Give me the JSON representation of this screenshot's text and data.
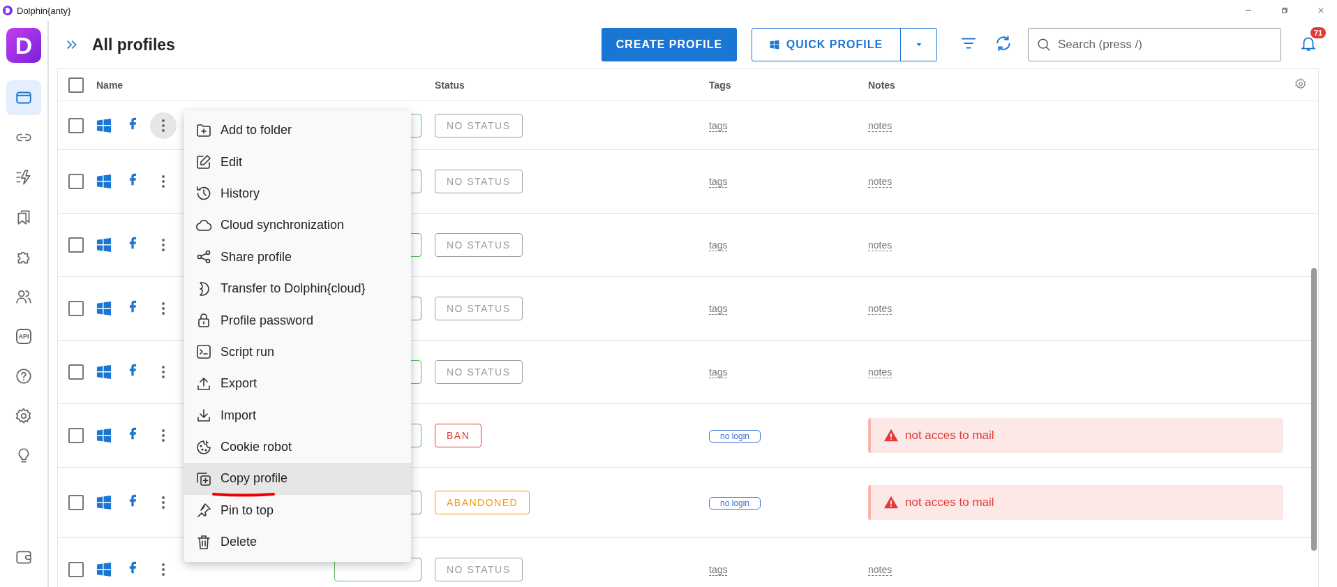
{
  "window": {
    "title": "Dolphin{anty}"
  },
  "sidebar": {
    "logo": "D",
    "items": [
      {
        "kind": "browser",
        "selected": true
      },
      {
        "kind": "link",
        "selected": false
      },
      {
        "kind": "automation",
        "selected": false
      },
      {
        "kind": "bookmarks",
        "selected": false
      },
      {
        "kind": "extension",
        "selected": false
      },
      {
        "kind": "users",
        "selected": false
      },
      {
        "kind": "api",
        "label": "API",
        "selected": false
      },
      {
        "kind": "help",
        "selected": false
      },
      {
        "kind": "settings",
        "selected": false
      },
      {
        "kind": "idea",
        "selected": false
      },
      {
        "kind": "wallet",
        "selected": false
      }
    ]
  },
  "header": {
    "title": "All profiles",
    "create_button": "CREATE PROFILE",
    "quick_button": "QUICK PROFILE",
    "search": {
      "placeholder": "Search (press /)"
    },
    "notifications": "71"
  },
  "table": {
    "select_all_checked": false,
    "columns": [
      "Name",
      "Status",
      "Tags",
      "Notes"
    ],
    "rows": [
      {
        "checked": false,
        "menu_open": true,
        "status": {
          "text": "NO STATUS",
          "color": "#9e9e9e"
        },
        "tags": {
          "kind": "placeholder",
          "text": "tags"
        },
        "notes": {
          "kind": "placeholder",
          "text": "notes"
        }
      },
      {
        "checked": false,
        "menu_open": false,
        "status": {
          "text": "NO STATUS",
          "color": "#9e9e9e"
        },
        "tags": {
          "kind": "placeholder",
          "text": "tags"
        },
        "notes": {
          "kind": "placeholder",
          "text": "notes"
        }
      },
      {
        "checked": false,
        "menu_open": false,
        "status": {
          "text": "NO STATUS",
          "color": "#9e9e9e"
        },
        "tags": {
          "kind": "placeholder",
          "text": "tags"
        },
        "notes": {
          "kind": "placeholder",
          "text": "notes"
        }
      },
      {
        "checked": false,
        "menu_open": false,
        "status": {
          "text": "NO STATUS",
          "color": "#9e9e9e"
        },
        "tags": {
          "kind": "placeholder",
          "text": "tags"
        },
        "notes": {
          "kind": "placeholder",
          "text": "notes"
        }
      },
      {
        "checked": false,
        "menu_open": false,
        "status": {
          "text": "NO STATUS",
          "color": "#9e9e9e"
        },
        "tags": {
          "kind": "placeholder",
          "text": "tags"
        },
        "notes": {
          "kind": "placeholder",
          "text": "notes"
        }
      },
      {
        "checked": false,
        "menu_open": false,
        "status": {
          "text": "BAN",
          "color": "#e53935"
        },
        "tags": {
          "kind": "tag",
          "text": "no login"
        },
        "notes": {
          "kind": "alert",
          "text": "not acces to mail"
        }
      },
      {
        "checked": false,
        "menu_open": false,
        "status": {
          "text": "ABANDONED",
          "color": "#ff9800"
        },
        "tags": {
          "kind": "tag",
          "text": "no login"
        },
        "notes": {
          "kind": "alert",
          "text": "not acces to mail"
        }
      },
      {
        "checked": false,
        "menu_open": false,
        "status": {
          "text": "NO STATUS",
          "color": "#9e9e9e"
        },
        "tags": {
          "kind": "placeholder",
          "text": "tags"
        },
        "notes": {
          "kind": "placeholder",
          "text": "notes"
        }
      }
    ]
  },
  "context_menu": {
    "items": [
      {
        "kind": "folder-plus",
        "label": "Add to folder",
        "selected": false
      },
      {
        "kind": "edit",
        "label": "Edit",
        "selected": false
      },
      {
        "kind": "history",
        "label": "History",
        "selected": false
      },
      {
        "kind": "cloud",
        "label": "Cloud synchronization",
        "selected": false
      },
      {
        "kind": "share",
        "label": "Share profile",
        "selected": false
      },
      {
        "kind": "transfer",
        "label": "Transfer to Dolphin{cloud}",
        "selected": false
      },
      {
        "kind": "lock",
        "label": "Profile password",
        "selected": false
      },
      {
        "kind": "terminal",
        "label": "Script run",
        "selected": false
      },
      {
        "kind": "upload",
        "label": "Export",
        "selected": false
      },
      {
        "kind": "download",
        "label": "Import",
        "selected": false
      },
      {
        "kind": "cookie",
        "label": "Cookie robot",
        "selected": false
      },
      {
        "kind": "copy",
        "label": "Copy profile",
        "selected": true,
        "underlined": true
      },
      {
        "kind": "pin",
        "label": "Pin to top",
        "selected": false
      },
      {
        "kind": "trash",
        "label": "Delete",
        "selected": false
      }
    ]
  }
}
